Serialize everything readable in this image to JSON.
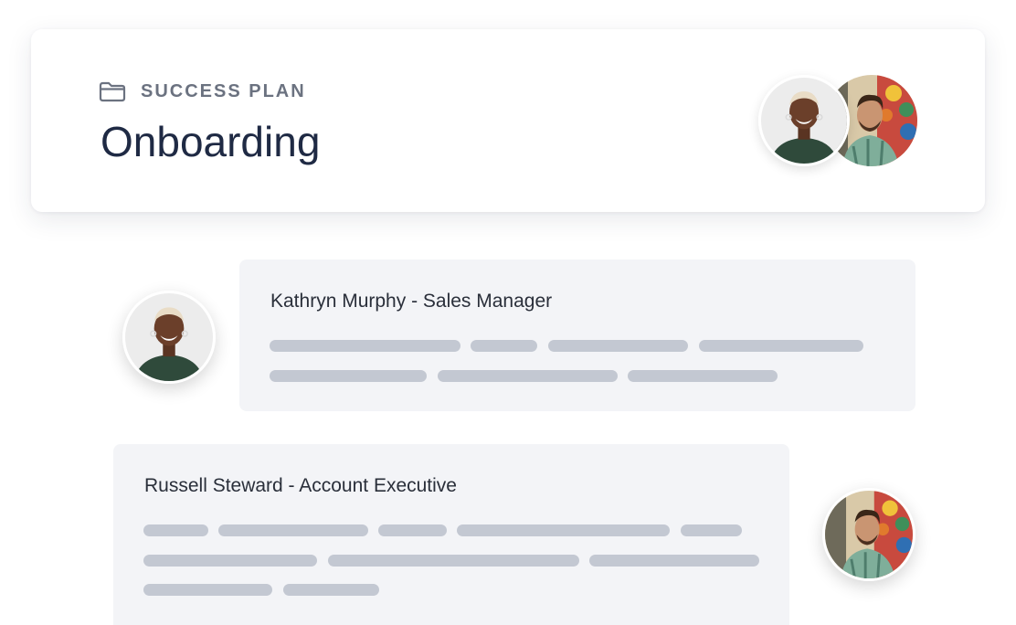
{
  "header": {
    "eyebrow_icon": "folder-icon",
    "eyebrow_label": "SUCCESS PLAN",
    "title": "Onboarding"
  },
  "participants": [
    {
      "name": "Kathryn Murphy - Sales Manager",
      "avatar": "avatar-kathryn-murphy"
    },
    {
      "name": "Russell Steward - Account Executive",
      "avatar": "avatar-russell-steward"
    }
  ],
  "colors": {
    "title": "#1f2a44",
    "eyebrow": "#6b7280",
    "card_background": "#f3f4f7",
    "skeleton_line": "#c3c8d2"
  }
}
